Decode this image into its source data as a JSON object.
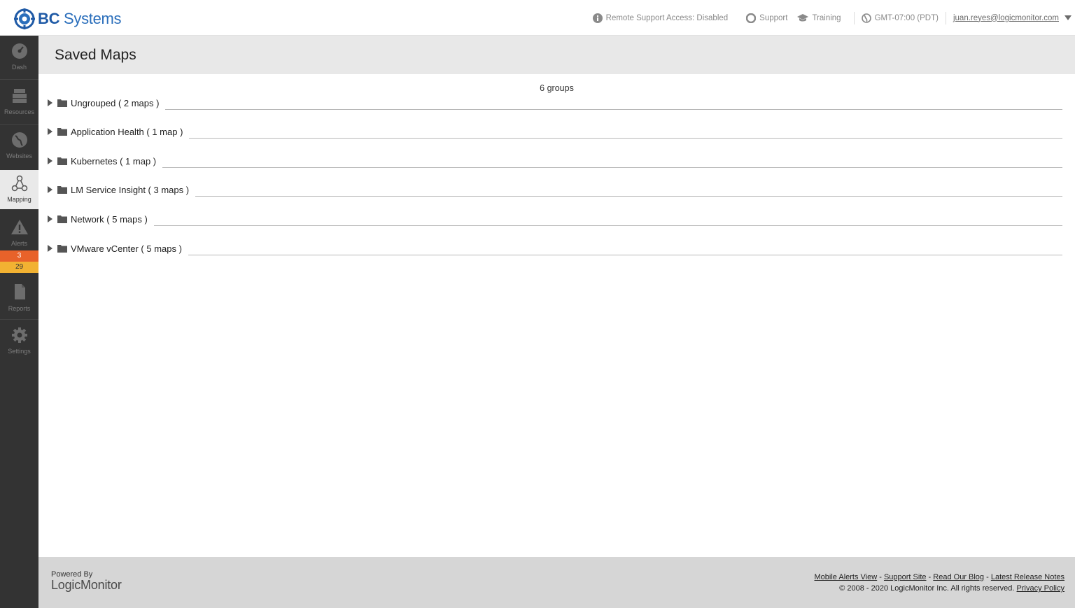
{
  "header": {
    "brand_bold": "BC",
    "brand_rest": " Systems",
    "remote_support": "Remote Support Access: Disabled",
    "support": "Support",
    "training": "Training",
    "timezone": "GMT-07:00 (PDT)",
    "user": "juan.reyes@logicmonitor.com"
  },
  "sidebar": {
    "items": [
      {
        "label": "Dash",
        "icon": "dashboard-icon"
      },
      {
        "label": "Resources",
        "icon": "resources-icon"
      },
      {
        "label": "Websites",
        "icon": "globe-icon"
      },
      {
        "label": "Mapping",
        "icon": "topology-icon",
        "active": true
      },
      {
        "label": "Alerts",
        "icon": "warning-icon"
      },
      {
        "label": "Reports",
        "icon": "document-icon"
      },
      {
        "label": "Settings",
        "icon": "gear-icon"
      }
    ],
    "alert_badges": {
      "critical": "3",
      "warning": "29"
    }
  },
  "page": {
    "title": "Saved Maps",
    "group_count": "6 groups",
    "groups": [
      "Ungrouped ( 2 maps )",
      "Application Health ( 1 map )",
      "Kubernetes ( 1 map )",
      "LM Service Insight ( 3 maps )",
      "Network ( 5 maps )",
      "VMware vCenter ( 5 maps )"
    ]
  },
  "footer": {
    "powered_by": "Powered By",
    "logo_text": "LogicMonitor",
    "links": [
      "Mobile Alerts View",
      "Support Site",
      "Read Our Blog",
      "Latest Release Notes"
    ],
    "link_separator": " - ",
    "copyright": "© 2008 - 2020 LogicMonitor Inc. All rights reserved.",
    "privacy": "Privacy Policy"
  },
  "colors": {
    "sidebar_bg": "#333333",
    "brand_blue": "#2a6ebb",
    "critical": "#e8622a",
    "warning": "#f2b232"
  }
}
